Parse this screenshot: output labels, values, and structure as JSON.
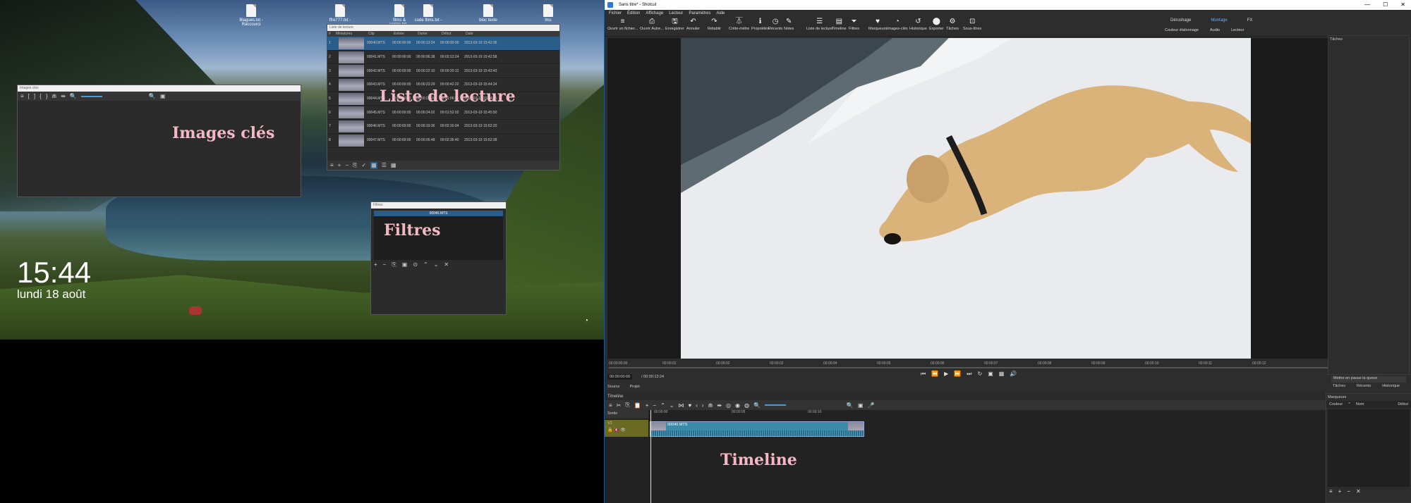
{
  "desktop": {
    "icons": [
      {
        "label": "Blagues.txt -\nRaccourci"
      },
      {
        "label": "ffre777.txt -"
      },
      {
        "label": "films & series.txt -"
      },
      {
        "label": "code films.txt -"
      },
      {
        "label": "bloc texte"
      },
      {
        "label": "lms"
      }
    ],
    "clock": "15:44",
    "date": "lundi 18 août",
    "annotations": {
      "keyframes": "Images clés",
      "playlist": "Liste de lecture",
      "filters": "Filtres",
      "timeline": "Timeline"
    }
  },
  "keyframes_panel": {
    "title": "Images clés",
    "toolbar": [
      "≡",
      "[",
      "]",
      "{",
      "}",
      "⋒",
      "⇹",
      "🔍",
      "🔍",
      "▣"
    ]
  },
  "playlist_panel": {
    "title": "Liste de lecture",
    "columns": [
      "#",
      "Miniatures",
      "Clip",
      "Entrée",
      "Durée",
      "Début",
      "Date"
    ],
    "rows": [
      {
        "n": "1",
        "clip": "00040.MTS",
        "in": "00:00:00:00",
        "dur": "00:00:13:24",
        "start": "00:00:00:00",
        "date": "2013-03-19 15:42:36"
      },
      {
        "n": "2",
        "clip": "00041.MTS",
        "in": "00:00:00:00",
        "dur": "00:00:06:38",
        "start": "00:00:13:24",
        "date": "2013-03-19 15:42:58"
      },
      {
        "n": "3",
        "clip": "00042.MTS",
        "in": "00:00:00:00",
        "dur": "00:00:22:10",
        "start": "00:00:20:12",
        "date": "2013-03-19 15:43:43"
      },
      {
        "n": "4",
        "clip": "00043.MTS",
        "in": "00:00:00:00",
        "dur": "00:00:23:29",
        "start": "00:00:42:22",
        "date": "2013-03-19 15:44:24"
      },
      {
        "n": "5",
        "clip": "00044.MTS",
        "in": "00:00:00:00",
        "dur": "00:00:23:24",
        "start": "00:01:06:21",
        "date": "2013-03-19 15:44:55"
      },
      {
        "n": "6",
        "clip": "00045.MTS",
        "in": "00:00:00:00",
        "dur": "00:00:24:02",
        "start": "00:01:52:02",
        "date": "2013-03-19 15:45:50"
      },
      {
        "n": "7",
        "clip": "00046.MTS",
        "in": "00:00:00:00",
        "dur": "00:00:19:36",
        "start": "00:02:16:04",
        "date": "2013-03-19 15:52:20"
      },
      {
        "n": "8",
        "clip": "00047.MTS",
        "in": "00:00:00:00",
        "dur": "00:00:05:48",
        "start": "00:02:35:40",
        "date": "2013-03-19 15:52:38"
      }
    ],
    "toolbar": [
      "≡",
      "+",
      "−",
      "⎘",
      "✓",
      "▦",
      "☰",
      "▦"
    ]
  },
  "filters_panel": {
    "title": "Filtres",
    "clip": "00040.MTS",
    "toolbar": [
      "+",
      "−",
      "⎘",
      "▣",
      "⊙",
      "⌃",
      "⌄",
      "✕"
    ]
  },
  "app": {
    "title": "Sans titre* - Shotcut",
    "menu": [
      "Fichier",
      "Édition",
      "Affichage",
      "Lecteur",
      "Paramètres",
      "Aide"
    ],
    "toolbar": [
      {
        "icon": "≡",
        "label": "Ouvrir un fichier..."
      },
      {
        "icon": "⎙",
        "label": "Ouvrir Autre..."
      },
      {
        "icon": "🖫",
        "label": "Enregistrer"
      },
      {
        "icon": "↶",
        "label": "Annuler"
      },
      {
        "icon": "↷",
        "label": "Rétablir"
      },
      {
        "icon": "⏄",
        "label": "Crête-mètre"
      },
      {
        "icon": "ℹ",
        "label": "Propriétés"
      },
      {
        "icon": "◷",
        "label": "Récents"
      },
      {
        "icon": "✎",
        "label": "Notes"
      },
      {
        "icon": "☰",
        "label": "Liste de lecture"
      },
      {
        "icon": "▤",
        "label": "Timeline"
      },
      {
        "icon": "⏷",
        "label": "Filtres"
      },
      {
        "icon": "♥",
        "label": "Marqueurs"
      },
      {
        "icon": "◔",
        "label": "Images-clés"
      },
      {
        "icon": "↺",
        "label": "Historique"
      },
      {
        "icon": "⬤",
        "label": "Exporter"
      },
      {
        "icon": "⚙",
        "label": "Tâches"
      },
      {
        "icon": "⊡",
        "label": "Sous-titres"
      }
    ],
    "layouts": [
      "Dérushage",
      "Montage",
      "FX",
      "Couleur étalonnage",
      "Audio",
      "Lecteur"
    ],
    "ruler": [
      "00:00:00:00",
      "00:00:01",
      "00:00:02",
      "00:00:03",
      "00:00:04",
      "00:00:05",
      "00:00:06",
      "00:00:07",
      "00:00:08",
      "00:00:09",
      "00:00:10",
      "00:00:11",
      "00:00:12"
    ],
    "timecode": "00:00:00:00",
    "duration": "/ 00:00:13:24",
    "source_tabs": [
      "Source",
      "Projet"
    ],
    "timeline_title": "Timeline",
    "tracks": [
      "Sortie",
      "V1"
    ],
    "tl_ruler": [
      "00:00:00",
      "00:00:05",
      "00:00:10"
    ],
    "clip": "00040.MTS",
    "right_top": "Tâches",
    "queue": "Mettre en pause la queue",
    "right_tabs": [
      "Tâches",
      "Récents",
      "Historique"
    ],
    "markers_title": "Marqueurs",
    "markers_cols": [
      "Couleur",
      "^",
      "Nom",
      "Début"
    ]
  }
}
